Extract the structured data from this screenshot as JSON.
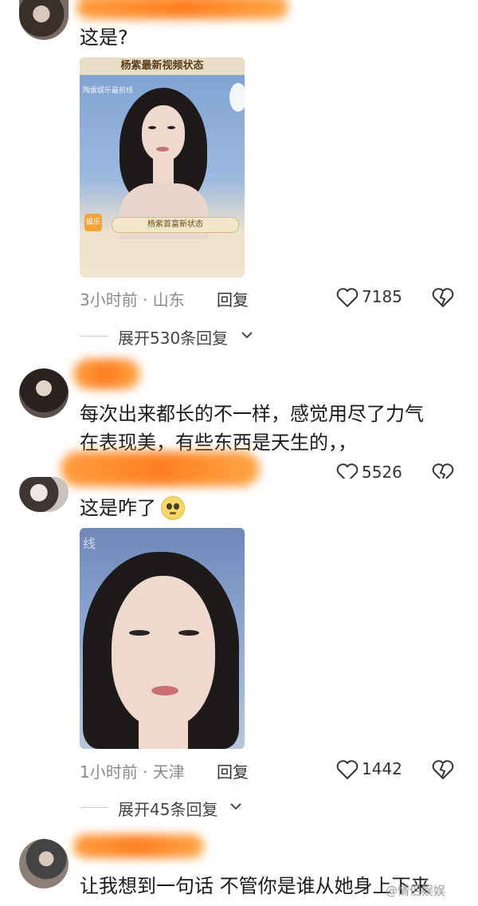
{
  "comments": [
    {
      "text": "这是?",
      "time": "3小时前 · 山东",
      "reply_label": "回复",
      "likes": "7185",
      "expand_label": "展开530条回复",
      "thumbnail": {
        "banner": "杨紫最新视频状态",
        "watermark": "陶雷娱乐最前线",
        "caption": "杨紫首富新状态",
        "logo": "娱乐"
      }
    },
    {
      "text_line1": "每次出来都长的不一样，感觉用尽了力气",
      "text_line2": "在表现美，有些东西是天生的，，",
      "likes": "5526"
    },
    {
      "text": "这是咋了",
      "emoji": "pleading-face",
      "time": "1小时前 · 天津",
      "reply_label": "回复",
      "likes": "1442",
      "expand_label": "展开45条回复",
      "thumbnail": {
        "watermark": "线"
      }
    },
    {
      "text": "让我想到一句话 不管你是谁从她身上下来"
    }
  ],
  "watermark": "@情侣娱娱",
  "colors": {
    "redaction": "#ff8c1e",
    "meta_text": "#8a8a8a",
    "divider": "#cfcfcf"
  }
}
